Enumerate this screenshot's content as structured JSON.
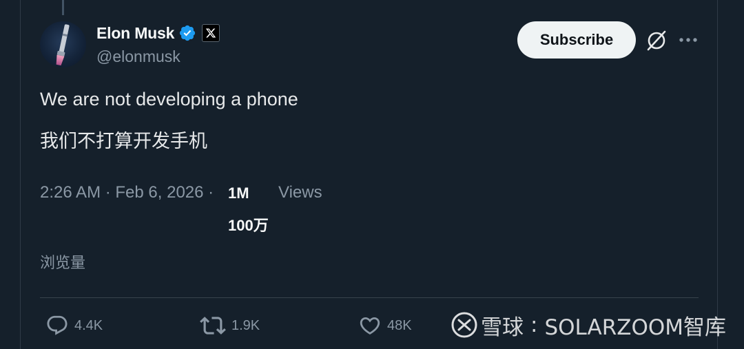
{
  "tweet": {
    "author": {
      "display_name": "Elon Musk",
      "handle": "@elonmusk",
      "verified": true,
      "affiliate_badge_icon": "x-logo-icon"
    },
    "subscribe_label": "Subscribe",
    "text_en": "We are not developing a phone",
    "text_zh": "我们不打算开发手机",
    "timestamp": "2:26 AM · Feb 6, 2026 ·",
    "views_count": "1M",
    "views_label": "Views",
    "views_count_zh": "100万",
    "views_label_zh": "浏览量",
    "actions": {
      "replies": "4.4K",
      "retweets": "1.9K",
      "likes": "48K"
    }
  },
  "watermark": {
    "left_text": "雪球",
    "right_text": "SOLARZOOM智库"
  },
  "colors": {
    "background": "#15202b",
    "text_primary": "#e7e9ea",
    "text_secondary": "#8b98a5",
    "verified_blue": "#1d9bf0",
    "button_bg": "#eff3f4"
  }
}
